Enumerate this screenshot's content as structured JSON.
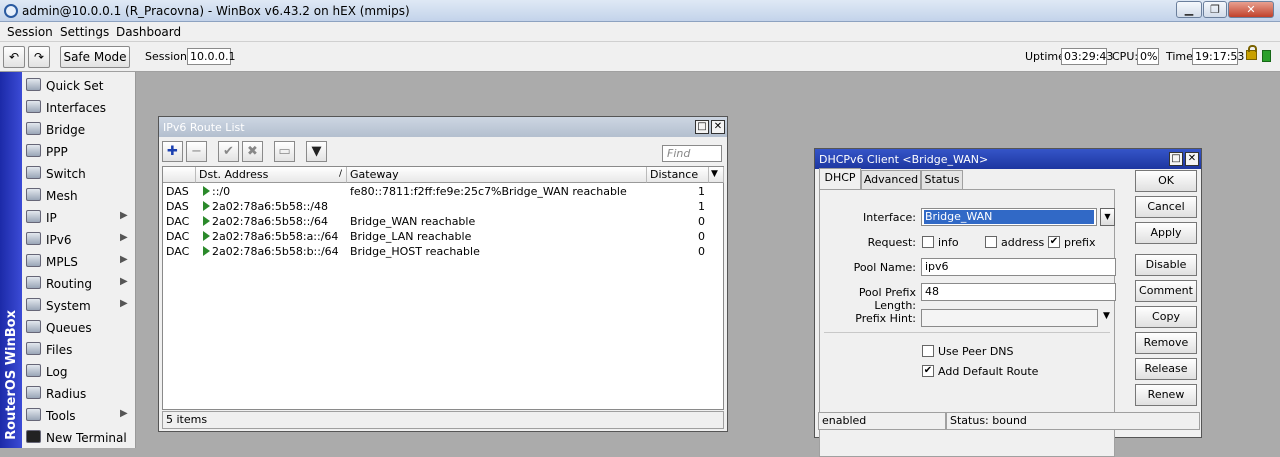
{
  "app": {
    "title": "admin@10.0.0.1 (R_Pracovna) - WinBox v6.43.2 on hEX (mmips)"
  },
  "menu": [
    "Session",
    "Settings",
    "Dashboard"
  ],
  "toolbar": {
    "safe_mode": "Safe Mode",
    "session_label": "Session:",
    "session_value": "10.0.0.1",
    "uptime_label": "Uptime:",
    "uptime_value": "03:29:43",
    "cpu_label": "CPU:",
    "cpu_value": "0%",
    "time_label": "Time:",
    "time_value": "19:17:53"
  },
  "vstrip_text": "RouterOS WinBox",
  "sidebar": {
    "items": [
      {
        "label": "Quick Set",
        "icon": "quickset-icon",
        "submenu": false
      },
      {
        "label": "Interfaces",
        "icon": "interfaces-icon",
        "submenu": false
      },
      {
        "label": "Bridge",
        "icon": "bridge-icon",
        "submenu": false
      },
      {
        "label": "PPP",
        "icon": "ppp-icon",
        "submenu": false
      },
      {
        "label": "Switch",
        "icon": "switch-icon",
        "submenu": false
      },
      {
        "label": "Mesh",
        "icon": "mesh-icon",
        "submenu": false
      },
      {
        "label": "IP",
        "icon": "ip-icon",
        "submenu": true
      },
      {
        "label": "IPv6",
        "icon": "ipv6-icon",
        "submenu": true
      },
      {
        "label": "MPLS",
        "icon": "mpls-icon",
        "submenu": true
      },
      {
        "label": "Routing",
        "icon": "routing-icon",
        "submenu": true
      },
      {
        "label": "System",
        "icon": "system-icon",
        "submenu": true
      },
      {
        "label": "Queues",
        "icon": "queues-icon",
        "submenu": false
      },
      {
        "label": "Files",
        "icon": "files-icon",
        "submenu": false
      },
      {
        "label": "Log",
        "icon": "log-icon",
        "submenu": false
      },
      {
        "label": "Radius",
        "icon": "radius-icon",
        "submenu": false
      },
      {
        "label": "Tools",
        "icon": "tools-icon",
        "submenu": true
      },
      {
        "label": "New Terminal",
        "icon": "terminal-icon",
        "submenu": false
      }
    ]
  },
  "route_list": {
    "title": "IPv6 Route List",
    "find_placeholder": "Find",
    "columns": [
      "Dst. Address",
      "Gateway",
      "Distance"
    ],
    "rows": [
      {
        "flags": "DAS",
        "dst": "::/0",
        "gateway": "fe80::7811:f2ff:fe9e:25c7%Bridge_WAN reachable",
        "distance": "1"
      },
      {
        "flags": "DAS",
        "dst": "2a02:78a6:5b58::/48",
        "gateway": "",
        "distance": "1"
      },
      {
        "flags": "DAC",
        "dst": "2a02:78a6:5b58::/64",
        "gateway": "Bridge_WAN reachable",
        "distance": "0"
      },
      {
        "flags": "DAC",
        "dst": "2a02:78a6:5b58:a::/64",
        "gateway": "Bridge_LAN reachable",
        "distance": "0"
      },
      {
        "flags": "DAC",
        "dst": "2a02:78a6:5b58:b::/64",
        "gateway": "Bridge_HOST reachable",
        "distance": "0"
      }
    ],
    "status": "5 items"
  },
  "dhcp": {
    "title": "DHCPv6 Client <Bridge_WAN>",
    "tabs": [
      "DHCP",
      "Advanced",
      "Status"
    ],
    "interface_label": "Interface:",
    "interface_value": "Bridge_WAN",
    "request_label": "Request:",
    "request_info": "info",
    "request_address": "address",
    "request_prefix": "prefix",
    "pool_name_label": "Pool Name:",
    "pool_name_value": "ipv6",
    "pool_prefix_label": "Pool Prefix Length:",
    "pool_prefix_value": "48",
    "prefix_hint_label": "Prefix Hint:",
    "use_peer_dns": "Use Peer DNS",
    "add_default_route": "Add Default Route",
    "buttons": [
      "OK",
      "Cancel",
      "Apply",
      "Disable",
      "Comment",
      "Copy",
      "Remove",
      "Release",
      "Renew"
    ],
    "status_left": "enabled",
    "status_right": "Status: bound"
  }
}
